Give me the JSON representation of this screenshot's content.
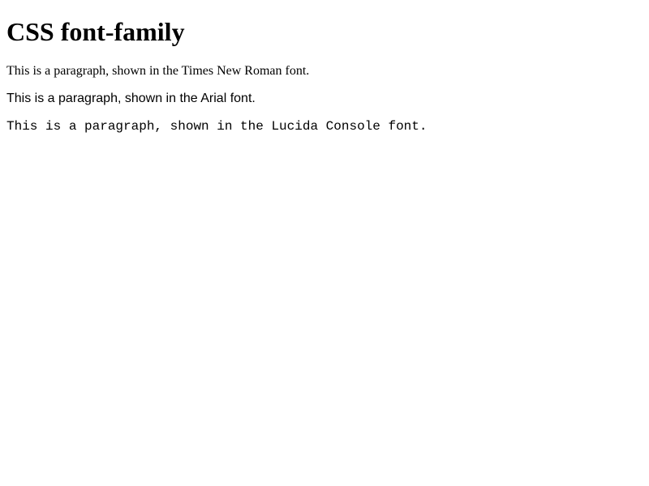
{
  "heading": "CSS font-family",
  "paragraphs": {
    "times": "This is a paragraph, shown in the Times New Roman font.",
    "arial": "This is a paragraph, shown in the Arial font.",
    "lucida": "This is a paragraph, shown in the Lucida Console font."
  }
}
